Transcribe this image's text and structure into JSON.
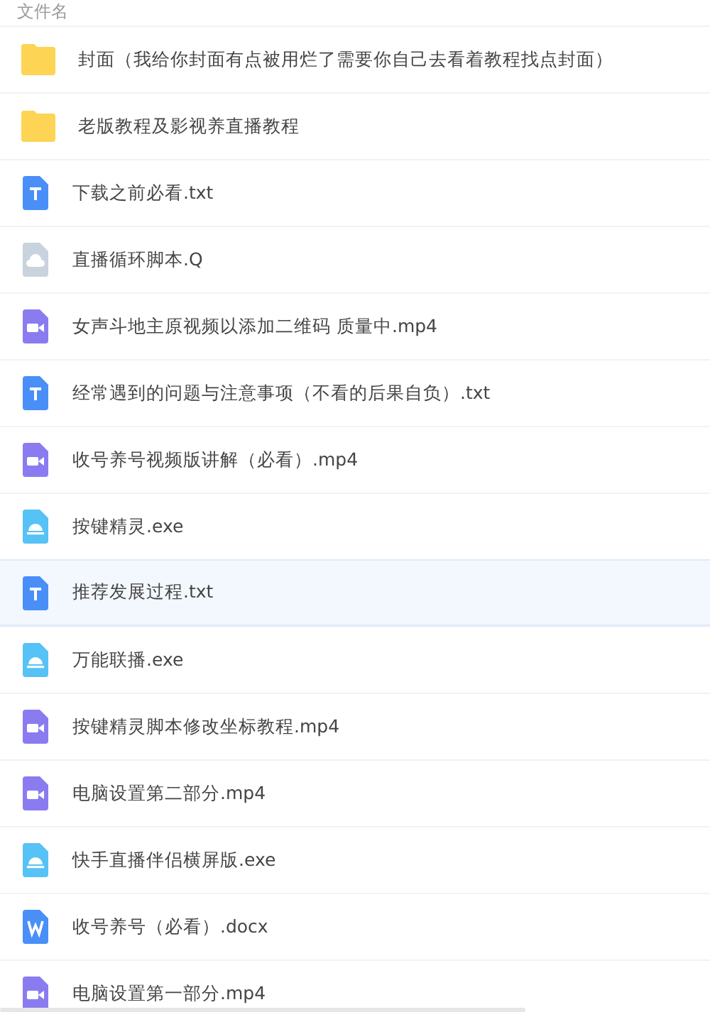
{
  "header": {
    "label": "文件名"
  },
  "files": [
    {
      "name": "封面（我给你封面有点被用烂了需要你自己去看着教程找点封面）",
      "kind": "folder",
      "selected": false
    },
    {
      "name": "老版教程及影视养直播教程",
      "kind": "folder",
      "selected": false
    },
    {
      "name": "下载之前必看.txt",
      "kind": "txt",
      "selected": false
    },
    {
      "name": "直播循环脚本.Q",
      "kind": "unknown",
      "selected": false
    },
    {
      "name": "女声斗地主原视频以添加二维码 质量中.mp4",
      "kind": "video",
      "selected": false
    },
    {
      "name": "经常遇到的问题与注意事项（不看的后果自负）.txt",
      "kind": "txt",
      "selected": false
    },
    {
      "name": "收号养号视频版讲解（必看）.mp4",
      "kind": "video",
      "selected": false
    },
    {
      "name": "按键精灵.exe",
      "kind": "exe",
      "selected": false
    },
    {
      "name": "推荐发展过程.txt",
      "kind": "txt",
      "selected": true
    },
    {
      "name": "万能联播.exe",
      "kind": "exe",
      "selected": false
    },
    {
      "name": "按键精灵脚本修改坐标教程.mp4",
      "kind": "video",
      "selected": false
    },
    {
      "name": "电脑设置第二部分.mp4",
      "kind": "video",
      "selected": false
    },
    {
      "name": "快手直播伴侣横屏版.exe",
      "kind": "exe",
      "selected": false
    },
    {
      "name": "收号养号（必看）.docx",
      "kind": "doc",
      "selected": false
    },
    {
      "name": "电脑设置第一部分.mp4",
      "kind": "video",
      "selected": false
    }
  ]
}
